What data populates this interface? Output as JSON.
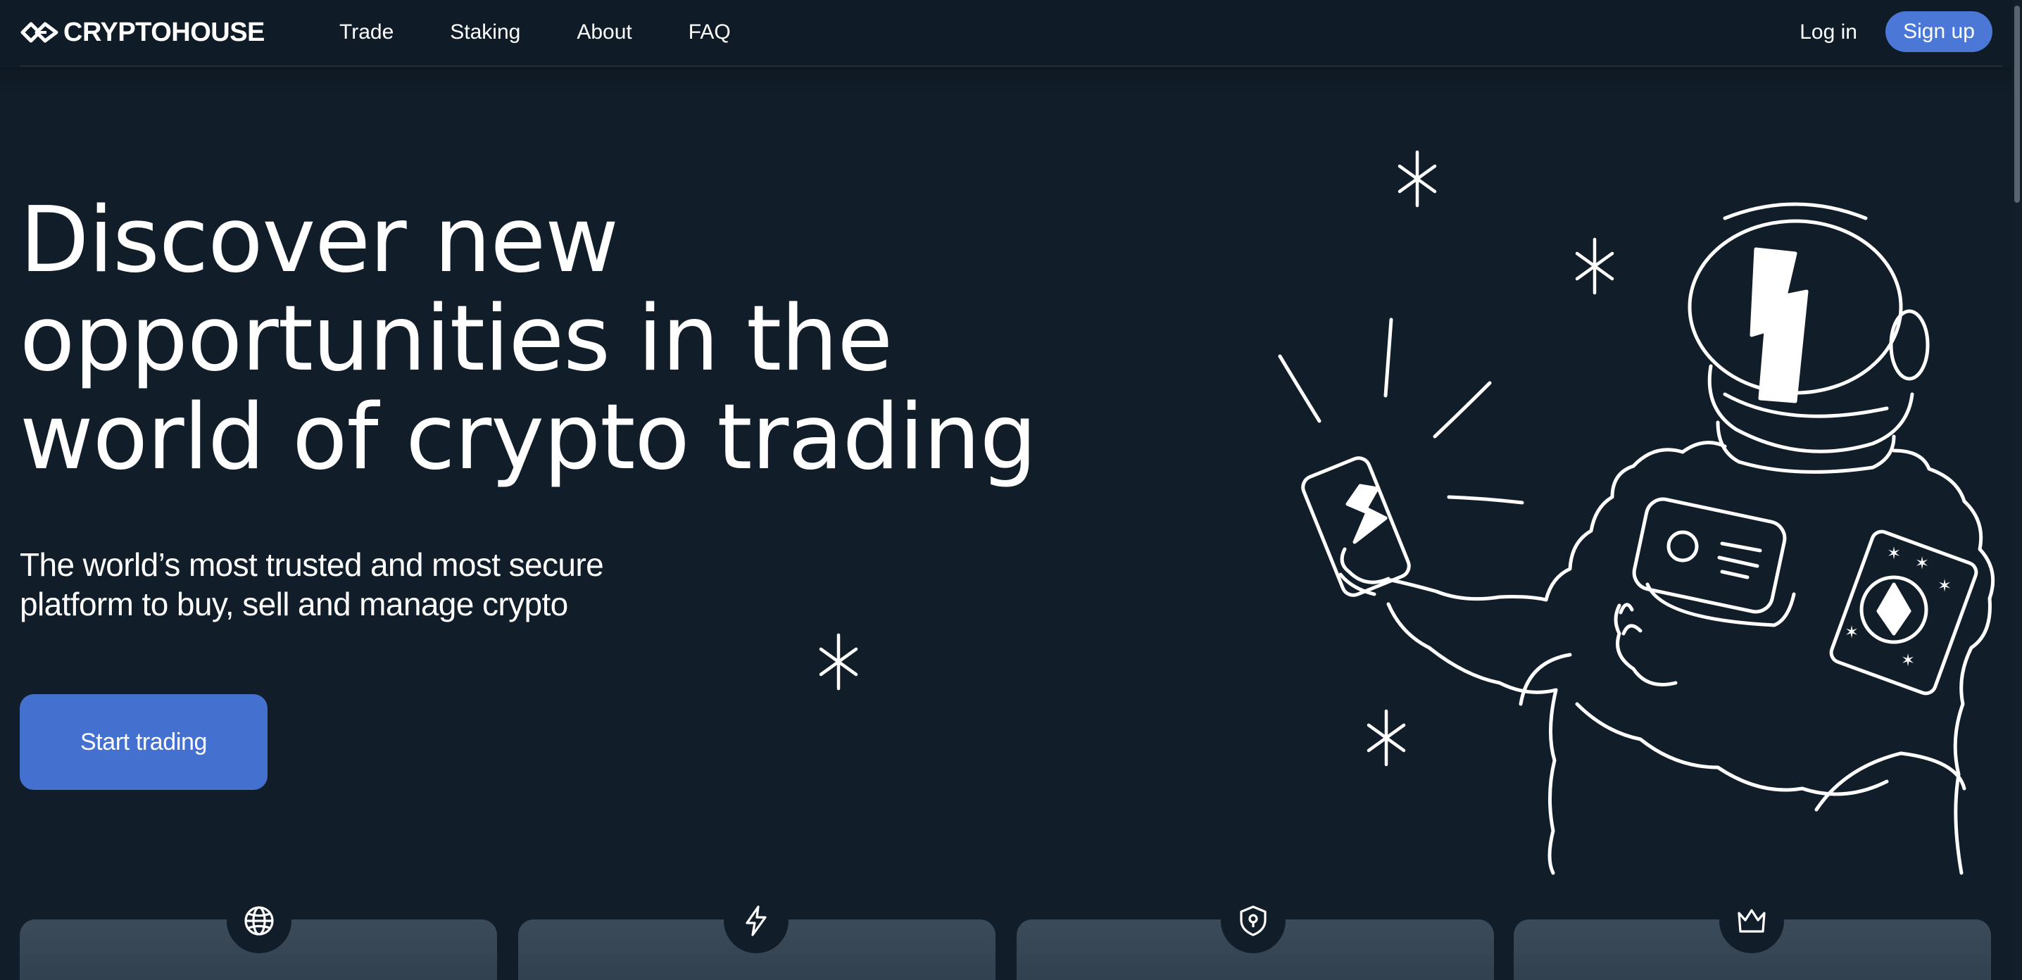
{
  "header": {
    "logo_text": "CRYPTOHOUSE",
    "nav": [
      "Trade",
      "Staking",
      "About",
      "FAQ"
    ],
    "login_label": "Log in",
    "signup_label": "Sign up"
  },
  "hero": {
    "title_lines": [
      "Discover new",
      "opportunities in the",
      "world of crypto trading"
    ],
    "subtitle_lines": [
      "The world’s most trusted and most secure",
      "platform to buy, sell and manage crypto"
    ],
    "cta_label": "Start trading"
  },
  "features": {
    "card_icons": [
      "globe-icon",
      "lightning-icon",
      "shield-icon",
      "crown-icon"
    ]
  },
  "colors": {
    "background": "#111e29",
    "accent": "#4b78d6",
    "card": "#344351"
  }
}
